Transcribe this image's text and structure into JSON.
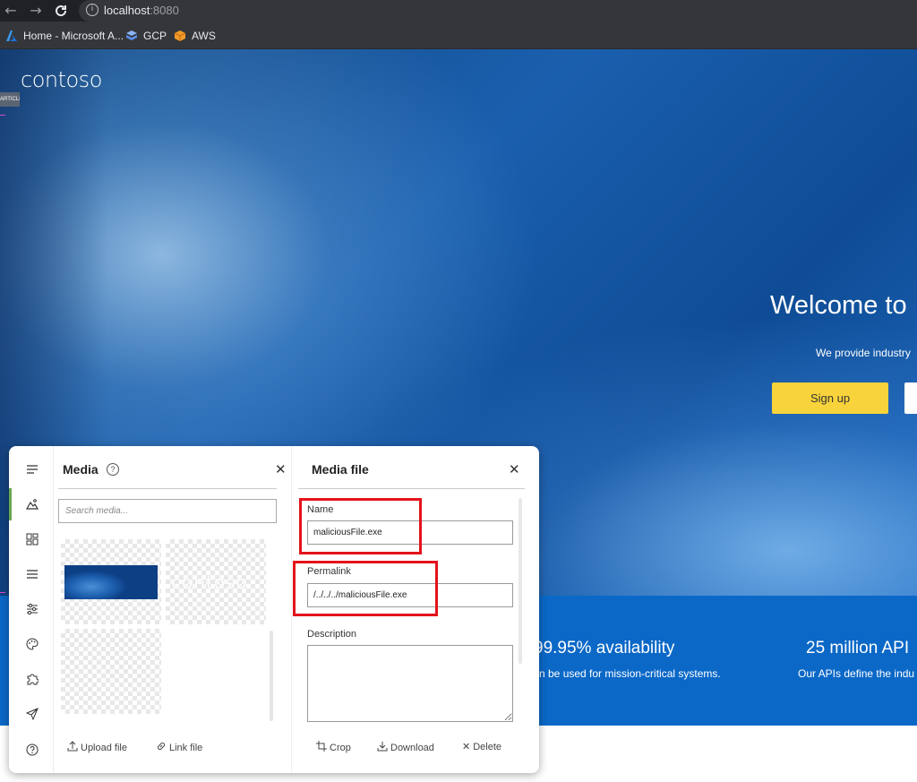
{
  "browser": {
    "url_host": "localhost",
    "url_port": ":8080",
    "bookmarks": [
      {
        "label": "Home - Microsoft A...",
        "icon": "azure-icon"
      },
      {
        "label": "GCP",
        "icon": "gcp-icon"
      },
      {
        "label": "AWS",
        "icon": "aws-icon"
      }
    ]
  },
  "site": {
    "logo": "contoso",
    "article_tag": "ARTICLE",
    "hero_title": "Welcome to",
    "hero_subtitle": "We provide industry",
    "signup_label": "Sign up",
    "stats": [
      {
        "title": "99.95% availability",
        "subtitle": "n be used for mission-critical systems."
      },
      {
        "title": "25 million API",
        "subtitle": "Our APIs define the indu"
      }
    ],
    "colors": {
      "accent_yellow": "#f8d33b",
      "stats_blue": "#0b68c7",
      "highlight_red": "#e3131b"
    }
  },
  "toolbar": {
    "icons": [
      "menu-icon",
      "media-icon",
      "widgets-icon",
      "list-icon",
      "sliders-icon",
      "palette-icon",
      "puzzle-icon",
      "send-icon",
      "help-icon"
    ]
  },
  "media_pane": {
    "title": "Media",
    "search_placeholder": "Search media...",
    "thumb_ghost_text": "contoso",
    "upload_label": "Upload file",
    "link_label": "Link file"
  },
  "file_pane": {
    "title": "Media file",
    "name_label": "Name",
    "name_value": "maliciousFile.exe",
    "permalink_label": "Permalink",
    "permalink_value": "/../../../maliciousFile.exe",
    "description_label": "Description",
    "description_value": "",
    "crop_label": "Crop",
    "download_label": "Download",
    "delete_label": "Delete"
  }
}
